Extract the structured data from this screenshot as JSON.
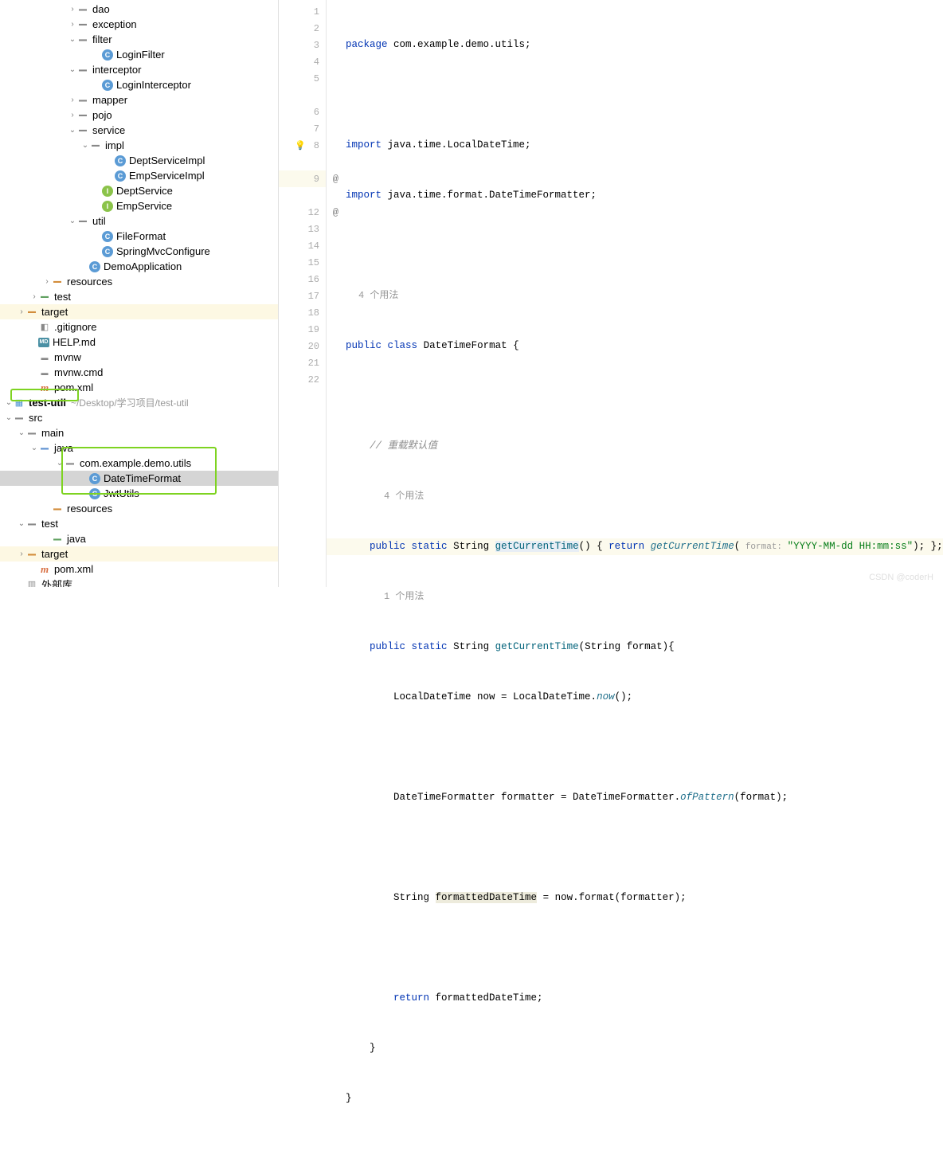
{
  "tree": [
    {
      "indent": 5,
      "arrow": "closed",
      "icon": "folder",
      "label": "dao"
    },
    {
      "indent": 5,
      "arrow": "closed",
      "icon": "folder",
      "label": "exception"
    },
    {
      "indent": 5,
      "arrow": "open",
      "icon": "folder",
      "label": "filter"
    },
    {
      "indent": 7,
      "arrow": "none",
      "icon": "class",
      "label": "LoginFilter"
    },
    {
      "indent": 5,
      "arrow": "open",
      "icon": "folder",
      "label": "interceptor"
    },
    {
      "indent": 7,
      "arrow": "none",
      "icon": "class",
      "label": "LoginInterceptor"
    },
    {
      "indent": 5,
      "arrow": "closed",
      "icon": "folder",
      "label": "mapper"
    },
    {
      "indent": 5,
      "arrow": "closed",
      "icon": "folder",
      "label": "pojo"
    },
    {
      "indent": 5,
      "arrow": "open",
      "icon": "folder",
      "label": "service"
    },
    {
      "indent": 6,
      "arrow": "open",
      "icon": "folder",
      "label": "impl"
    },
    {
      "indent": 8,
      "arrow": "none",
      "icon": "class",
      "label": "DeptServiceImpl"
    },
    {
      "indent": 8,
      "arrow": "none",
      "icon": "class",
      "label": "EmpServiceImpl"
    },
    {
      "indent": 7,
      "arrow": "none",
      "icon": "interface",
      "label": "DeptService"
    },
    {
      "indent": 7,
      "arrow": "none",
      "icon": "interface",
      "label": "EmpService"
    },
    {
      "indent": 5,
      "arrow": "open",
      "icon": "folder",
      "label": "util"
    },
    {
      "indent": 7,
      "arrow": "none",
      "icon": "class",
      "label": "FileFormat"
    },
    {
      "indent": 7,
      "arrow": "none",
      "icon": "class",
      "label": "SpringMvcConfigure"
    },
    {
      "indent": 6,
      "arrow": "none",
      "icon": "class",
      "label": "DemoApplication"
    },
    {
      "indent": 3,
      "arrow": "closed",
      "icon": "folder-orange",
      "label": "resources"
    },
    {
      "indent": 2,
      "arrow": "closed",
      "icon": "folder-green",
      "label": "test"
    },
    {
      "indent": 1,
      "arrow": "closed",
      "icon": "folder-orange",
      "label": "target",
      "class": "folder-target",
      "bg": "#fdf8e3"
    },
    {
      "indent": 2,
      "arrow": "none",
      "icon": "gitignore",
      "label": ".gitignore"
    },
    {
      "indent": 2,
      "arrow": "none",
      "icon": "md",
      "label": "HELP.md"
    },
    {
      "indent": 2,
      "arrow": "none",
      "icon": "file",
      "label": "mvnw"
    },
    {
      "indent": 2,
      "arrow": "none",
      "icon": "file",
      "label": "mvnw.cmd"
    },
    {
      "indent": 2,
      "arrow": "none",
      "icon": "maven",
      "label": "pom.xml"
    },
    {
      "indent": 0,
      "arrow": "open",
      "icon": "module",
      "label": "test-util",
      "bold": true,
      "path": "~/Desktop/学习项目/test-util"
    },
    {
      "indent": 0,
      "arrow": "open",
      "icon": "folder",
      "label": "src"
    },
    {
      "indent": 1,
      "arrow": "open",
      "icon": "folder",
      "label": "main"
    },
    {
      "indent": 2,
      "arrow": "open",
      "icon": "folder-blue",
      "label": "java"
    },
    {
      "indent": 4,
      "arrow": "open",
      "icon": "folder",
      "label": "com.example.demo.utils"
    },
    {
      "indent": 6,
      "arrow": "none",
      "icon": "class",
      "label": "DateTimeFormat",
      "selected": true
    },
    {
      "indent": 6,
      "arrow": "none",
      "icon": "class",
      "label": "JwtUtils"
    },
    {
      "indent": 3,
      "arrow": "none",
      "icon": "folder-orange",
      "label": "resources"
    },
    {
      "indent": 1,
      "arrow": "open",
      "icon": "folder",
      "label": "test"
    },
    {
      "indent": 3,
      "arrow": "none",
      "icon": "folder-green",
      "label": "java"
    },
    {
      "indent": 1,
      "arrow": "closed",
      "icon": "folder-orange",
      "label": "target",
      "bg": "#fdf8e3"
    },
    {
      "indent": 2,
      "arrow": "none",
      "icon": "maven",
      "label": "pom.xml"
    },
    {
      "indent": 1,
      "arrow": "none",
      "icon": "libs",
      "label": "外部库"
    }
  ],
  "gutter": [
    {
      "n": "1"
    },
    {
      "n": "2"
    },
    {
      "n": "3"
    },
    {
      "n": "4"
    },
    {
      "n": "5"
    },
    {
      "hint": true,
      "text": "4 个用法"
    },
    {
      "n": "6"
    },
    {
      "n": "7"
    },
    {
      "n": "8",
      "bulb": true
    },
    {
      "hint": true,
      "text": "4 个用法"
    },
    {
      "n": "9",
      "override": true,
      "hl": true
    },
    {
      "hint": true,
      "text": "1 个用法"
    },
    {
      "n": "12",
      "override": true
    },
    {
      "n": "13"
    },
    {
      "n": "14"
    },
    {
      "n": "15"
    },
    {
      "n": "16"
    },
    {
      "n": "17"
    },
    {
      "n": "18"
    },
    {
      "n": "19"
    },
    {
      "n": "20"
    },
    {
      "n": "21"
    },
    {
      "n": "22"
    }
  ],
  "code": {
    "l1_kw": "package",
    "l1_rest": " com.example.demo.utils;",
    "l3_kw": "import",
    "l3_rest": " java.time.LocalDateTime;",
    "l4_kw": "import",
    "l4_rest": " java.time.format.DateTimeFormatter;",
    "l6_kw1": "public",
    "l6_kw2": "class",
    "l6_name": "DateTimeFormat",
    "l6_brace": " {",
    "l8_com": "// 重载默认值",
    "l9_kw1": "public",
    "l9_kw2": "static",
    "l9_type": "String",
    "l9_m1": "getCurrentTime",
    "l9_p1": "() { ",
    "l9_kw3": "return",
    "l9_m2": " getCurrentTime",
    "l9_p2": "(",
    "l9_hint": " format: ",
    "l9_str": "\"YYYY-MM-dd HH:mm:ss\"",
    "l9_end": "); };",
    "l12_kw1": "public",
    "l12_kw2": "static",
    "l12_type": "String",
    "l12_m": "getCurrentTime",
    "l12_params": "(String format){",
    "l13_a": "LocalDateTime now = LocalDateTime.",
    "l13_m": "now",
    "l13_end": "();",
    "l15_a": "DateTimeFormatter formatter = DateTimeFormatter.",
    "l15_m": "ofPattern",
    "l15_end": "(format);",
    "l17_a": "String ",
    "l17_hl": "formattedDateTime",
    "l17_end": " = now.format(formatter);",
    "l19_kw": "return",
    "l19_rest": " formattedDateTime;",
    "l20": "}",
    "l21": "}"
  },
  "hints": {
    "h1": "4 个用法",
    "h2": "4 个用法",
    "h3": "1 个用法"
  },
  "watermark": "CSDN @coderH"
}
